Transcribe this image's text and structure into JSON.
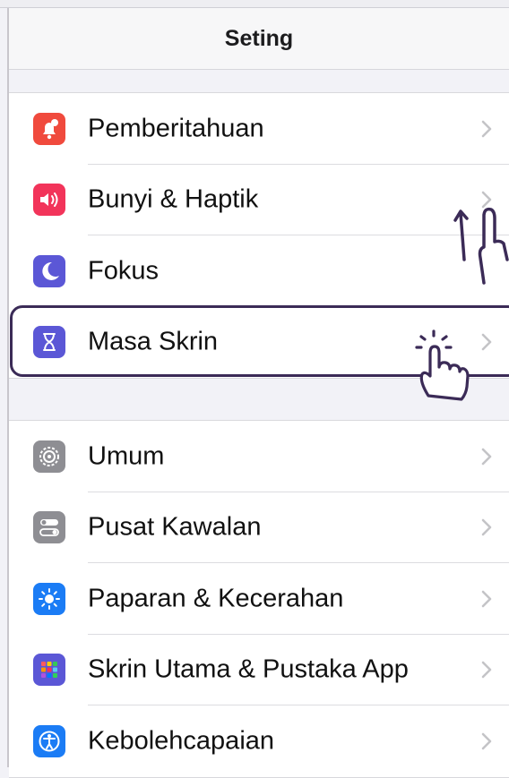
{
  "header": {
    "title": "Seting"
  },
  "settings": {
    "group1": [
      {
        "label": "Pemberitahuan",
        "icon": "notifications-icon",
        "color": "#f04a3d"
      },
      {
        "label": "Bunyi & Haptik",
        "icon": "speaker-icon",
        "color": "#f2345a"
      },
      {
        "label": "Fokus",
        "icon": "moon-icon",
        "color": "#5b57d6"
      },
      {
        "label": "Masa Skrin",
        "icon": "hourglass-icon",
        "color": "#5b57d6",
        "highlighted": true
      }
    ],
    "group2": [
      {
        "label": "Umum",
        "icon": "gear-icon",
        "color": "#8e8e93"
      },
      {
        "label": "Pusat Kawalan",
        "icon": "toggles-icon",
        "color": "#8e8e93"
      },
      {
        "label": "Paparan & Kecerahan",
        "icon": "sun-icon",
        "color": "#1b7cf5"
      },
      {
        "label": "Skrin Utama & Pustaka App",
        "icon": "home-grid-icon",
        "color": "#5b57d6"
      },
      {
        "label": "Kebolehcapaian",
        "icon": "accessibility-icon",
        "color": "#1b7cf5"
      }
    ]
  },
  "annotations": {
    "highlight_color": "#3b2b57",
    "gestures": [
      "swipe-up-hand-icon",
      "tap-hand-icon"
    ]
  }
}
